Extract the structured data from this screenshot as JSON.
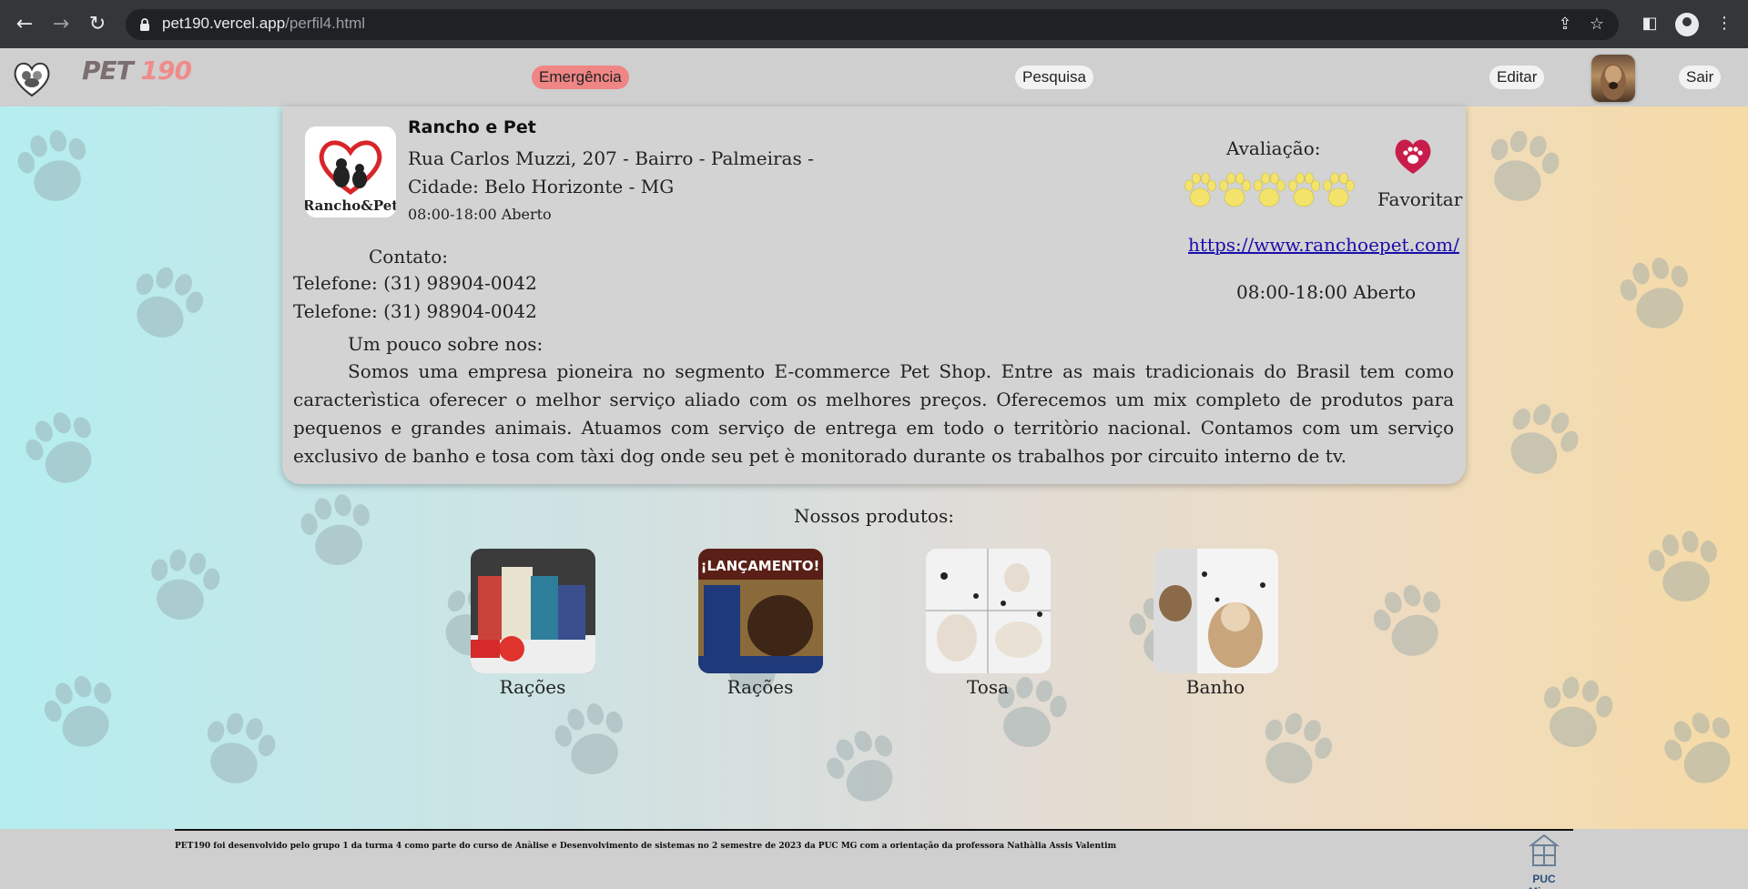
{
  "browser": {
    "url_host": "pet190.vercel.app",
    "url_path": "/perfil4.html"
  },
  "header": {
    "brand_text": "PET",
    "brand_num": "190",
    "emergency_label": "Emergência",
    "search_label": "Pesquisa",
    "edit_label": "Editar",
    "logout_label": "Sair"
  },
  "store": {
    "name": "Rancho e Pet",
    "address": "Rua Carlos Muzzi, 207 - Bairro - Palmeiras - Cidade: Belo Horizonte - MG",
    "hours_small": "08:00-18:00 Aberto",
    "contact_title": "Contato:",
    "phones": [
      "Telefone: (31) 98904-0042",
      "Telefone: (31) 98904-0042"
    ],
    "about_title": "Um pouco sobre nos:",
    "about": "Somos uma empresa pioneira no segmento E-commerce Pet Shop. Entre as mais tradicionais do Brasil tem como caracterìstica oferecer o melhor serviço aliado com os melhores preços. Oferecemos um mix completo de produtos para pequenos e grandes animais. Atuamos com serviço de entrega em todo o territòrio nacional. Contamos com um serviço exclusivo de banho e tosa com tàxi dog onde seu pet è monitorado durante os trabalhos por circuito interno de tv.",
    "rating_label": "Avaliação:",
    "rating": 5,
    "favorite_label": "Favoritar",
    "website": "https://www.ranchoepet.com/",
    "hours_right": "08:00-18:00 Aberto",
    "logo_text": "Rancho&Pet"
  },
  "products": {
    "title": "Nossos produtos:",
    "items": [
      {
        "label": "Rações"
      },
      {
        "label": "Rações",
        "banner": "¡LANÇAMENTO!"
      },
      {
        "label": "Tosa"
      },
      {
        "label": "Banho"
      }
    ]
  },
  "footer": {
    "credit": "PET190 foi desenvolvido pelo grupo 1 da turma 4 como parte do curso de Anàlise e Desenvolvimento de sistemas no 2 semestre de 2023 da PUC MG com a orientação da professora Nathàlia Assis Valentim",
    "puc_label": "PUC Minas"
  },
  "colors": {
    "emergency": "#ef8585",
    "link": "#1a0dab",
    "heart": "#c81d4a",
    "star_paw": "#f3e36a"
  }
}
